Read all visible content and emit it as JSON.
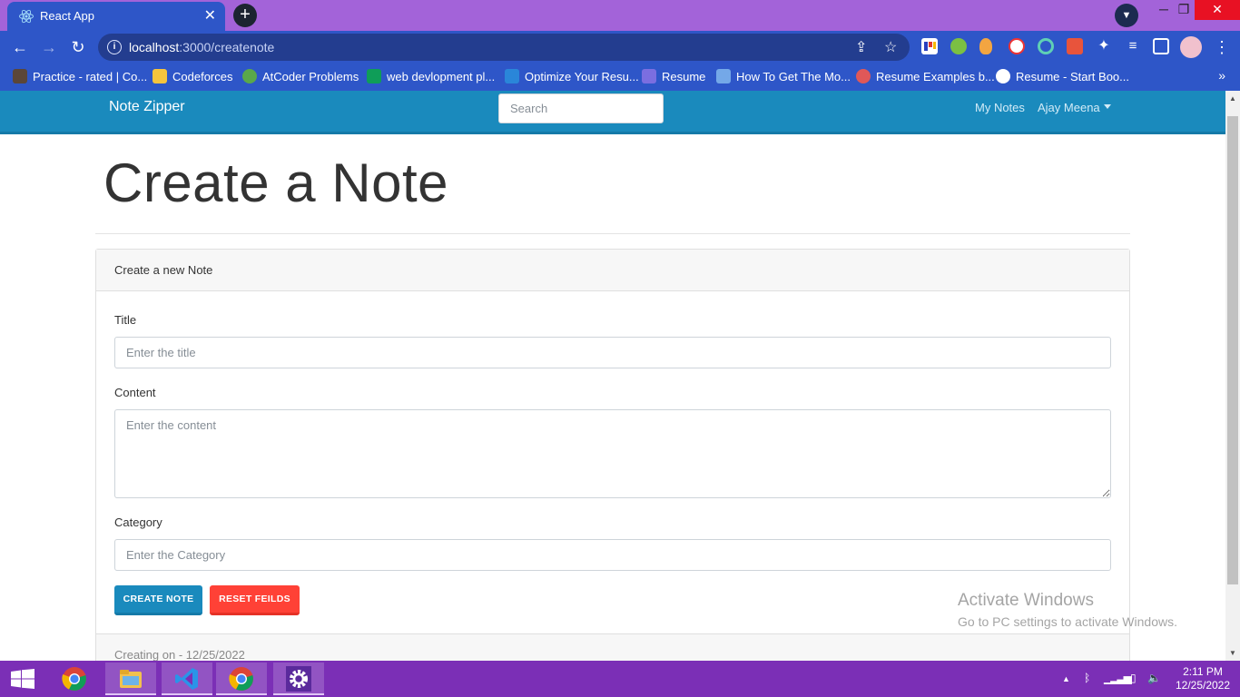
{
  "browser": {
    "tab_title": "React App",
    "url_host": "localhost",
    "url_path": ":3000/createnote"
  },
  "bookmarks": [
    {
      "label": "Practice - rated | Co...",
      "icon": "codechef-icon",
      "color": "#5b4638"
    },
    {
      "label": "Codeforces",
      "icon": "codeforces-icon",
      "color": "#f6c43d"
    },
    {
      "label": "AtCoder Problems",
      "icon": "atcoder-icon",
      "color": "#5aa84a"
    },
    {
      "label": "web devlopment pl...",
      "icon": "sheets-icon",
      "color": "#0f9d58"
    },
    {
      "label": "Optimize Your Resu...",
      "icon": "tie-icon",
      "color": "#2a86d9"
    },
    {
      "label": "Resume",
      "icon": "code-icon",
      "color": "#7b6ee0"
    },
    {
      "label": "How To Get The Mo...",
      "icon": "layers-icon",
      "color": "#74a8e8"
    },
    {
      "label": "Resume Examples b...",
      "icon": "link-icon",
      "color": "#e05858"
    },
    {
      "label": "Resume - Start Boo...",
      "icon": "globe-icon",
      "color": "#ffffff"
    }
  ],
  "navbar": {
    "brand": "Note Zipper",
    "search_placeholder": "Search",
    "my_notes": "My Notes",
    "user": "Ajay Meena"
  },
  "page": {
    "title": "Create a Note"
  },
  "card": {
    "header": "Create a new Note",
    "title_label": "Title",
    "title_placeholder": "Enter the title",
    "content_label": "Content",
    "content_placeholder": "Enter the content",
    "category_label": "Category",
    "category_placeholder": "Enter the Category",
    "create_button": "CREATE NOTE",
    "reset_button": "RESET FEILDS",
    "footer": "Creating on - 12/25/2022"
  },
  "watermark": {
    "line1": "Activate Windows",
    "line2": "Go to PC settings to activate Windows."
  },
  "taskbar": {
    "time": "2:11 PM",
    "date": "12/25/2022"
  },
  "colors": {
    "brand_primary": "#1a8abd",
    "danger": "#ff4136",
    "browser_frame": "#2e56c8",
    "tab_strip": "#a363d9",
    "taskbar": "#7b2fb6"
  }
}
